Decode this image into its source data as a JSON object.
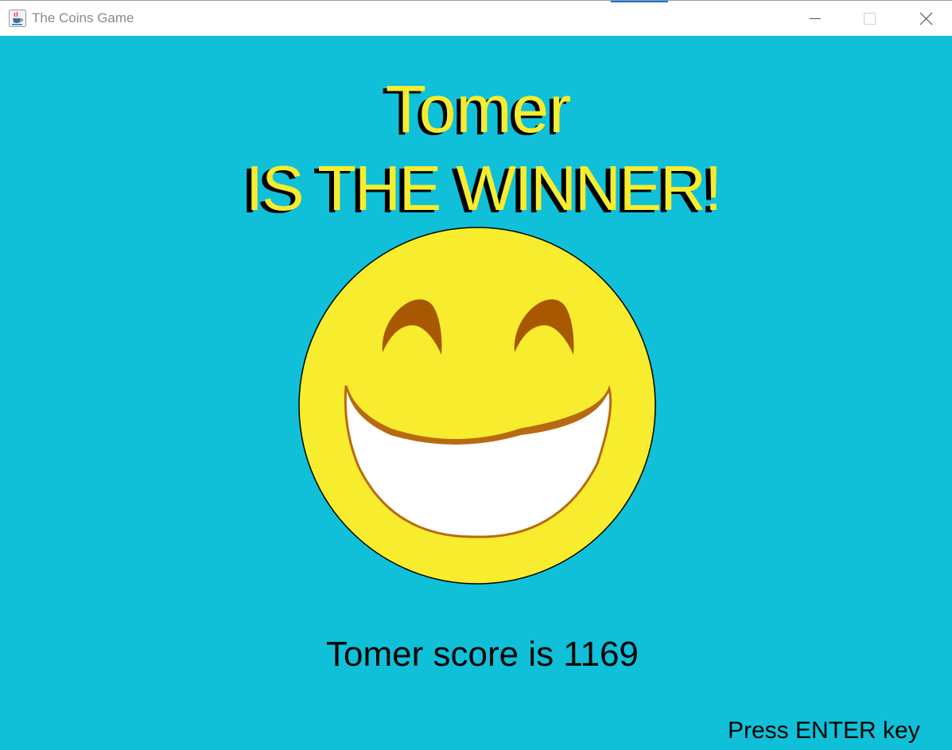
{
  "window": {
    "title": "The Coins Game",
    "app_icon": "java-cup-icon",
    "controls": {
      "minimize_icon": "minimize-icon",
      "maximize_icon": "maximize-icon",
      "close_icon": "close-icon"
    }
  },
  "game": {
    "background_color": "#0fc0d8",
    "winner_name": "Tomer",
    "winner_message": "IS THE WINNER!",
    "title_color": "#f7ec2e",
    "smiley": {
      "icon": "laughing-smiley-icon",
      "face_color": "#f7ec2e",
      "eye_color": "#a85800",
      "mouth_color": "#ffffff"
    },
    "score_text": "Tomer score is 1169",
    "hint_text": "Press ENTER key"
  }
}
